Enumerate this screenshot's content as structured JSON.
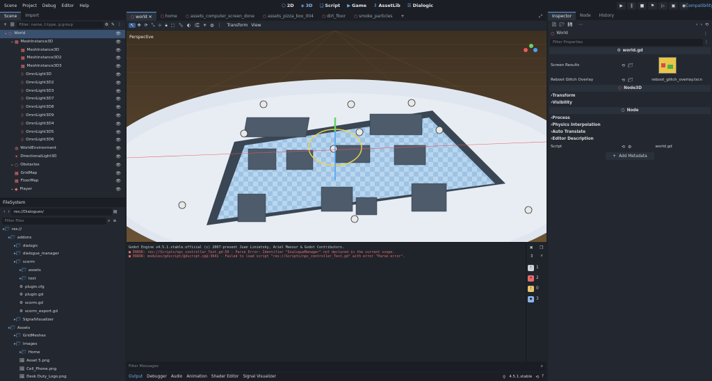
{
  "menu": [
    "Scene",
    "Project",
    "Debug",
    "Editor",
    "Help"
  ],
  "main_screens": [
    {
      "label": "2D",
      "glyph": "⬡"
    },
    {
      "label": "3D",
      "glyph": "◈"
    },
    {
      "label": "Script",
      "glyph": "❏"
    },
    {
      "label": "Game",
      "glyph": "▶"
    },
    {
      "label": "AssetLib",
      "glyph": "⇩"
    },
    {
      "label": "Dialogic",
      "glyph": "☰"
    }
  ],
  "renderer": "Compatibility",
  "scene_dock": {
    "tabs": [
      "Scene",
      "Import"
    ],
    "filter_placeholder": "Filter: name, t:type, g:group",
    "nodes": [
      {
        "label": "World",
        "icon": "node3d-icon",
        "indent": 0,
        "selected": true
      },
      {
        "label": "MeshInstance3D",
        "icon": "mesh-icon",
        "indent": 1
      },
      {
        "label": "MeshInstance3D",
        "icon": "mesh-icon",
        "indent": 2
      },
      {
        "label": "MeshInstance3D2",
        "icon": "mesh-icon",
        "indent": 2
      },
      {
        "label": "MeshInstance3D3",
        "icon": "mesh-icon",
        "indent": 2
      },
      {
        "label": "OmniLight3D",
        "icon": "light-icon",
        "indent": 2
      },
      {
        "label": "OmniLight3D2",
        "icon": "light-icon",
        "indent": 2
      },
      {
        "label": "OmniLight3D3",
        "icon": "light-icon",
        "indent": 2
      },
      {
        "label": "OmniLight3D7",
        "icon": "light-icon",
        "indent": 2
      },
      {
        "label": "OmniLight3D8",
        "icon": "light-icon",
        "indent": 2
      },
      {
        "label": "OmniLight3D9",
        "icon": "light-icon",
        "indent": 2
      },
      {
        "label": "OmniLight3D4",
        "icon": "light-icon",
        "indent": 2
      },
      {
        "label": "OmniLight3D5",
        "icon": "light-icon",
        "indent": 2
      },
      {
        "label": "OmniLight3D6",
        "icon": "light-icon",
        "indent": 2
      },
      {
        "label": "WorldEnvironment",
        "icon": "env-icon",
        "indent": 1
      },
      {
        "label": "DirectionalLight3D",
        "icon": "dirlight-icon",
        "indent": 1
      },
      {
        "label": "Obstacles",
        "icon": "node3d-icon",
        "indent": 1
      },
      {
        "label": "GridMap",
        "icon": "gridmap-icon",
        "indent": 1
      },
      {
        "label": "FloorMap",
        "icon": "gridmap-icon",
        "indent": 1
      },
      {
        "label": "Player",
        "icon": "player-icon",
        "indent": 1
      }
    ]
  },
  "filesystem": {
    "title": "FileSystem",
    "path": "res://Dialogues/",
    "filter_placeholder": "Filter Files",
    "items": [
      {
        "label": "res://",
        "type": "folder",
        "indent": 0
      },
      {
        "label": "addons",
        "type": "folder",
        "indent": 1
      },
      {
        "label": "dialogic",
        "type": "folder",
        "indent": 2
      },
      {
        "label": "dialogue_manager",
        "type": "folder",
        "indent": 2
      },
      {
        "label": "scorm",
        "type": "folder",
        "indent": 2
      },
      {
        "label": "assets",
        "type": "folder",
        "indent": 3
      },
      {
        "label": "test",
        "type": "folder",
        "indent": 3
      },
      {
        "label": "plugin.cfg",
        "type": "file",
        "indent": 3
      },
      {
        "label": "plugin.gd",
        "type": "script",
        "indent": 3
      },
      {
        "label": "scorm.gd",
        "type": "script",
        "indent": 3
      },
      {
        "label": "scorm_export.gd",
        "type": "script",
        "indent": 3
      },
      {
        "label": "SignalVisualizer",
        "type": "folder",
        "indent": 2
      },
      {
        "label": "Assets",
        "type": "folder",
        "indent": 1
      },
      {
        "label": "GridMeshes",
        "type": "folder",
        "indent": 2
      },
      {
        "label": "Images",
        "type": "folder",
        "indent": 2
      },
      {
        "label": "Home",
        "type": "folder",
        "indent": 3
      },
      {
        "label": "Asset 5.png",
        "type": "image",
        "indent": 3
      },
      {
        "label": "Cell_Phone.png",
        "type": "image",
        "indent": 3
      },
      {
        "label": "Desk Duty_Logo.png",
        "type": "image",
        "indent": 3
      }
    ]
  },
  "editor_tabs": [
    "world",
    "home",
    "assets_computer_screen_done",
    "assets_pizza_box_004",
    "dirt_floor",
    "smoke_particles"
  ],
  "viewport": {
    "toolbar_menus": [
      "Transform",
      "View"
    ],
    "perspective_label": "Perspective"
  },
  "output": {
    "lines": [
      {
        "text": "Godot Engine v4.5.1.stable.official (c) 2007-present Juan Linietsky, Ariel Manzur & Godot Contributors.",
        "type": "info"
      },
      {
        "text": "■ ERROR: res://Scripts/npc_controller_Test.gd:50 - Parse Error: Identifier \"DialogueManager\" not declared in the current scope.",
        "type": "error"
      },
      {
        "text": "■ ERROR: modules/gdscript/gdscript.cpp:3041 - Failed to load script \"res://Scripts/npc_controller_Test.gd\" with error \"Parse error\".",
        "type": "error"
      }
    ],
    "filter_placeholder": "Filter Messages",
    "counts": [
      {
        "value": "1",
        "color": "#cfd3d8"
      },
      {
        "value": "2",
        "color": "#e86a6a"
      },
      {
        "value": "0",
        "color": "#e8c56a"
      },
      {
        "value": "3",
        "color": "#8ab4e8"
      }
    ]
  },
  "bottom_tabs": [
    "Output",
    "Debugger",
    "Audio",
    "Animation",
    "Shader Editor",
    "Signal Visualizer"
  ],
  "version": "4.5.1.stable",
  "inspector": {
    "tabs": [
      "Inspector",
      "Node",
      "History"
    ],
    "object": "World",
    "filter_placeholder": "Filter Properties",
    "script_header": "world.gd",
    "screen_results_label": "Screen Results",
    "reboot_label": "Reboot Glitch Overlay",
    "reboot_value": "reboot_glitch_overlay.tscn",
    "node3d_header": "Node3D",
    "node3d_sections": [
      "Transform",
      "Visibility"
    ],
    "node_header": "Node",
    "node_sections": [
      "Process",
      "Physics Interpolation",
      "Auto Translate",
      "Editor Description"
    ],
    "script_label": "Script",
    "script_value": "world.gd",
    "add_metadata": "Add Metadata"
  }
}
